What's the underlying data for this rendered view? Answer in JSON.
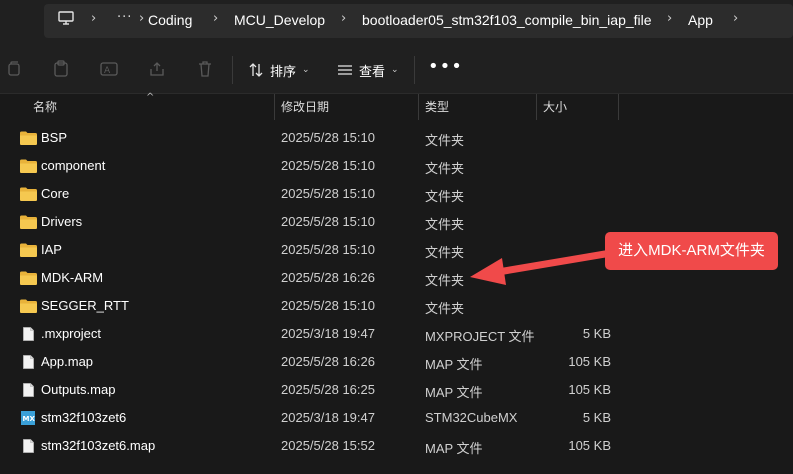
{
  "breadcrumb": {
    "items": [
      "Coding",
      "MCU_Develop",
      "bootloader05_stm32f103_compile_bin_iap_file",
      "App"
    ]
  },
  "toolbar": {
    "sort_label": "排序",
    "view_label": "查看"
  },
  "columns": {
    "name": "名称",
    "modified": "修改日期",
    "type": "类型",
    "size": "大小"
  },
  "files": [
    {
      "name": "BSP",
      "modified": "2025/5/28 15:10",
      "type": "文件夹",
      "size": "",
      "icon": "folder-icon"
    },
    {
      "name": "component",
      "modified": "2025/5/28 15:10",
      "type": "文件夹",
      "size": "",
      "icon": "folder-icon"
    },
    {
      "name": "Core",
      "modified": "2025/5/28 15:10",
      "type": "文件夹",
      "size": "",
      "icon": "folder-icon"
    },
    {
      "name": "Drivers",
      "modified": "2025/5/28 15:10",
      "type": "文件夹",
      "size": "",
      "icon": "folder-icon"
    },
    {
      "name": "IAP",
      "modified": "2025/5/28 15:10",
      "type": "文件夹",
      "size": "",
      "icon": "folder-icon"
    },
    {
      "name": "MDK-ARM",
      "modified": "2025/5/28 16:26",
      "type": "文件夹",
      "size": "",
      "icon": "folder-icon"
    },
    {
      "name": "SEGGER_RTT",
      "modified": "2025/5/28 15:10",
      "type": "文件夹",
      "size": "",
      "icon": "folder-icon"
    },
    {
      "name": ".mxproject",
      "modified": "2025/3/18 19:47",
      "type": "MXPROJECT 文件",
      "size": "5 KB",
      "icon": "file-icon"
    },
    {
      "name": "App.map",
      "modified": "2025/5/28 16:26",
      "type": "MAP 文件",
      "size": "105 KB",
      "icon": "file-icon"
    },
    {
      "name": "Outputs.map",
      "modified": "2025/5/28 16:25",
      "type": "MAP 文件",
      "size": "105 KB",
      "icon": "file-icon"
    },
    {
      "name": "stm32f103zet6",
      "modified": "2025/3/18 19:47",
      "type": "STM32CubeMX",
      "size": "5 KB",
      "icon": "cubemx-icon"
    },
    {
      "name": "stm32f103zet6.map",
      "modified": "2025/5/28 15:52",
      "type": "MAP 文件",
      "size": "105 KB",
      "icon": "file-icon"
    }
  ],
  "annotation": {
    "text": "进入MDK-ARM文件夹"
  },
  "colors": {
    "background": "#191919",
    "folder": "#f2c24c",
    "annotation": "#f04a4a"
  }
}
